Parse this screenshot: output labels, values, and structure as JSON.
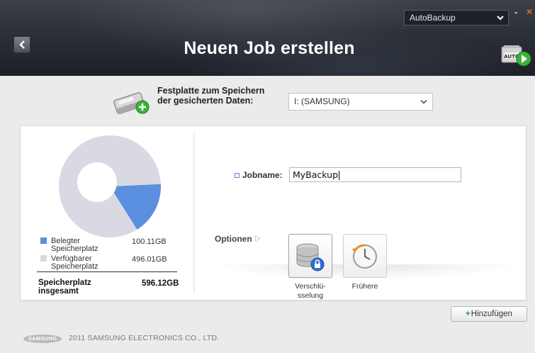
{
  "header": {
    "title": "Neuen Job erstellen",
    "profile_select": {
      "value": "AutoBackup"
    },
    "min_glyph": "-",
    "close_glyph": "×",
    "auto_icon_text": "AUTO"
  },
  "drive": {
    "label_line1": "Festplatte zum Speichern",
    "label_line2": "der gesicherten Daten:",
    "selected": "I: (SAMSUNG)"
  },
  "chart_data": {
    "type": "pie",
    "title": "",
    "slices": [
      {
        "name": "Belegter Speicherplatz",
        "value": 100.11,
        "color": "#5b8fe0"
      },
      {
        "name": "Verfügbarer Speicherplatz",
        "value": 496.01,
        "color": "#d9d9e3"
      }
    ]
  },
  "legend": {
    "items": [
      {
        "label_line1": "Belegter",
        "label_line2": "Speicherplatz",
        "value": "100.11GB",
        "color": "#5b8fe0"
      },
      {
        "label_line1": "Verfügbarer",
        "label_line2": "Speicherplatz",
        "value": "496.01GB",
        "color": "#d9d9d9"
      }
    ],
    "total_label_line1": "Speicherplatz",
    "total_label_line2": "insgesamt",
    "total_value": "596.12GB"
  },
  "job": {
    "label": "Jobname:",
    "value": "MyBackup"
  },
  "options": {
    "label": "Optionen",
    "arrow_glyph": "▷",
    "buttons": [
      {
        "label_line1": "Verschlü-",
        "label_line2": "sselung"
      },
      {
        "label_line1": "Frühere",
        "label_line2": ""
      }
    ]
  },
  "actions": {
    "add_plus": "+",
    "add_label": "Hinzufügen"
  },
  "footer": {
    "logo": "SAMSUNG",
    "copyright": "2011 SAMSUNG ELECTRONICS CO., LTD."
  }
}
